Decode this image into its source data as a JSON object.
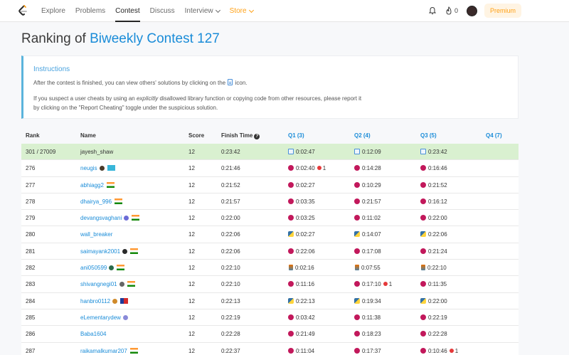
{
  "nav": {
    "items": [
      {
        "label": "Explore"
      },
      {
        "label": "Problems"
      },
      {
        "label": "Contest"
      },
      {
        "label": "Discuss"
      },
      {
        "label": "Interview"
      },
      {
        "label": "Store"
      }
    ],
    "fire_count": "0",
    "premium_label": "Premium"
  },
  "heading": {
    "prefix": "Ranking of",
    "contest": "Biweekly Contest 127"
  },
  "instructions": {
    "title": "Instructions",
    "p1_before": "After the contest is finished, you can view others' solutions by clicking on the",
    "p1_after": "icon.",
    "p2_before": "If you suspect a user cheats by using an",
    "p2_em": "explicitly",
    "p2_after": "disallowed library function or copying code from other resources, please report it by clicking on the \"Report Cheating\" toggle under the suspicious solution."
  },
  "table": {
    "headers": {
      "rank": "Rank",
      "name": "Name",
      "score": "Score",
      "finish": "Finish Time",
      "q1": "Q1 (3)",
      "q2": "Q2 (4)",
      "q3": "Q3 (5)",
      "q4": "Q4 (7)"
    },
    "rows": [
      {
        "rank": "301 / 27009",
        "name": "jayesh_shaw",
        "score": "12",
        "finish": "0:23:42",
        "q1": {
          "lang": "doc",
          "time": "0:02:47"
        },
        "q2": {
          "lang": "doc",
          "time": "0:12:09"
        },
        "q3": {
          "lang": "doc",
          "time": "0:23:42"
        }
      },
      {
        "rank": "276",
        "name": "neugis",
        "score": "12",
        "finish": "0:21:46",
        "q1": {
          "lang": "cpp",
          "time": "0:02:40",
          "bugs": "1"
        },
        "q2": {
          "lang": "cpp",
          "time": "0:14:28"
        },
        "q3": {
          "lang": "cpp",
          "time": "0:16:46"
        }
      },
      {
        "rank": "277",
        "name": "abhiagg2",
        "score": "12",
        "finish": "0:21:52",
        "q1": {
          "lang": "cpp",
          "time": "0:02:27"
        },
        "q2": {
          "lang": "cpp",
          "time": "0:10:29"
        },
        "q3": {
          "lang": "cpp",
          "time": "0:21:52"
        }
      },
      {
        "rank": "278",
        "name": "dhairya_996",
        "score": "12",
        "finish": "0:21:57",
        "q1": {
          "lang": "cpp",
          "time": "0:03:35"
        },
        "q2": {
          "lang": "cpp",
          "time": "0:21:57"
        },
        "q3": {
          "lang": "cpp",
          "time": "0:16:12"
        }
      },
      {
        "rank": "279",
        "name": "devangsvaghani",
        "score": "12",
        "finish": "0:22:00",
        "q1": {
          "lang": "cpp",
          "time": "0:03:25"
        },
        "q2": {
          "lang": "cpp",
          "time": "0:11:02"
        },
        "q3": {
          "lang": "cpp",
          "time": "0:22:00"
        }
      },
      {
        "rank": "280",
        "name": "wall_breaker",
        "score": "12",
        "finish": "0:22:06",
        "q1": {
          "lang": "py",
          "time": "0:02:27"
        },
        "q2": {
          "lang": "py",
          "time": "0:14:07"
        },
        "q3": {
          "lang": "py",
          "time": "0:22:06"
        }
      },
      {
        "rank": "281",
        "name": "saimayank2001",
        "score": "12",
        "finish": "0:22:06",
        "q1": {
          "lang": "cpp",
          "time": "0:22:06"
        },
        "q2": {
          "lang": "cpp",
          "time": "0:17:08"
        },
        "q3": {
          "lang": "cpp",
          "time": "0:21:24"
        }
      },
      {
        "rank": "282",
        "name": "ani050599",
        "score": "12",
        "finish": "0:22:10",
        "q1": {
          "lang": "java",
          "time": "0:02:16"
        },
        "q2": {
          "lang": "java",
          "time": "0:07:55"
        },
        "q3": {
          "lang": "java",
          "time": "0:22:10"
        }
      },
      {
        "rank": "283",
        "name": "shivangnegi01",
        "score": "12",
        "finish": "0:22:10",
        "q1": {
          "lang": "cpp",
          "time": "0:11:16"
        },
        "q2": {
          "lang": "cpp",
          "time": "0:17:10",
          "bugs": "1"
        },
        "q3": {
          "lang": "cpp",
          "time": "0:11:35"
        }
      },
      {
        "rank": "284",
        "name": "hanbro0112",
        "score": "12",
        "finish": "0:22:13",
        "q1": {
          "lang": "py",
          "time": "0:22:13"
        },
        "q2": {
          "lang": "py",
          "time": "0:19:34"
        },
        "q3": {
          "lang": "py",
          "time": "0:22:00"
        }
      },
      {
        "rank": "285",
        "name": "eLementarydew",
        "score": "12",
        "finish": "0:22:19",
        "q1": {
          "lang": "cpp",
          "time": "0:03:42"
        },
        "q2": {
          "lang": "cpp",
          "time": "0:11:38"
        },
        "q3": {
          "lang": "cpp",
          "time": "0:22:19"
        }
      },
      {
        "rank": "286",
        "name": "Baba1604",
        "score": "12",
        "finish": "0:22:28",
        "q1": {
          "lang": "cpp",
          "time": "0:21:49"
        },
        "q2": {
          "lang": "cpp",
          "time": "0:18:23"
        },
        "q3": {
          "lang": "cpp",
          "time": "0:22:28"
        }
      },
      {
        "rank": "287",
        "name": "raikamalkumar207",
        "score": "12",
        "finish": "0:22:37",
        "q1": {
          "lang": "cpp",
          "time": "0:11:04"
        },
        "q2": {
          "lang": "cpp",
          "time": "0:17:37"
        },
        "q3": {
          "lang": "cpp",
          "time": "0:10:46",
          "bugs": "1"
        }
      }
    ]
  }
}
